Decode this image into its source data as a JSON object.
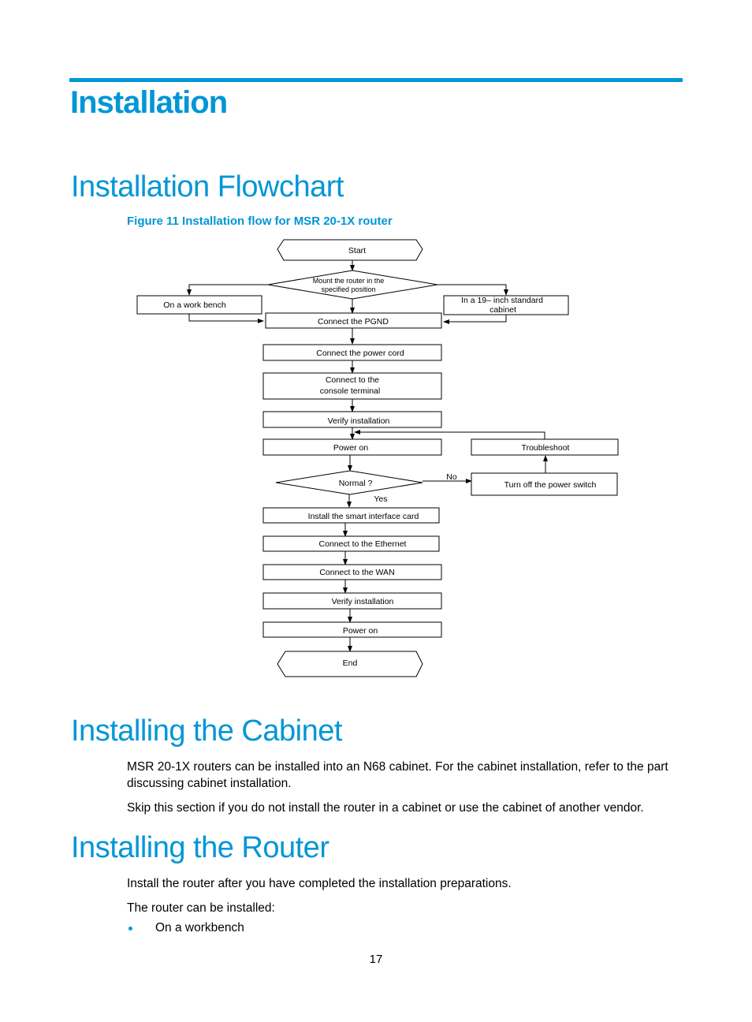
{
  "page": {
    "title": "Installation",
    "page_number": "17",
    "accent_color": "#0096D6"
  },
  "sections": {
    "flowchart": {
      "heading": "Installation Flowchart",
      "figure_caption": "Figure 11 Installation flow for MSR 20-1X router"
    },
    "cabinet": {
      "heading": "Installing the Cabinet",
      "paragraphs": [
        "MSR 20-1X routers can be installed into an N68 cabinet. For the cabinet installation, refer to the part discussing cabinet installation.",
        "Skip this section if you do not install the router in a cabinet or use the cabinet of another vendor."
      ]
    },
    "router": {
      "heading": "Installing the Router",
      "paragraphs": [
        "Install the router after you have completed the installation preparations.",
        "The router can be installed:"
      ],
      "bullets": [
        "On a workbench"
      ]
    }
  },
  "flowchart": {
    "start": "Start",
    "mount_decision": [
      "Mount the router in the",
      "specified position"
    ],
    "work_bench": "On a work bench",
    "cabinet_option": [
      "In a  19–  inch standard",
      "cabinet"
    ],
    "connect_pgnd": "Connect   the  PGND",
    "power_cord": "Connect the power cord",
    "console": [
      "Connect to the",
      "console terminal"
    ],
    "verify1": "Verify installation",
    "power_on1": "Power on",
    "troubleshoot": "Troubleshoot",
    "normal_decision": "Normal  ?",
    "no_label": "No",
    "yes_label": "Yes",
    "turn_off": "Turn off the power switch",
    "smart_card": "Install the smart interface card",
    "ethernet": "Connect to the Ethernet",
    "wan": "Connect to the WAN",
    "verify2": "Verify installation",
    "power_on2": "Power on",
    "end": "End"
  }
}
